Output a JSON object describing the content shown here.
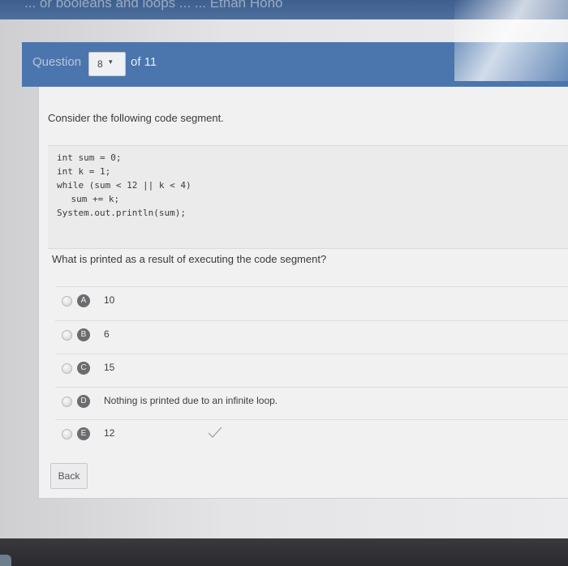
{
  "window": {
    "title": "... or booleans and loops ... ... Ethan Hono"
  },
  "header": {
    "question_label": "Question",
    "current_question": "8",
    "of_label": "of 11"
  },
  "question": {
    "prompt": "Consider the following code segment.",
    "code": [
      "int sum = 0;",
      "int k = 1;",
      "while (sum < 12 || k < 4)",
      "    sum += k;",
      "System.out.println(sum);"
    ],
    "text": "What is printed as a result of executing the code segment?",
    "options": [
      {
        "letter": "A",
        "text": "10"
      },
      {
        "letter": "B",
        "text": "6"
      },
      {
        "letter": "C",
        "text": "15"
      },
      {
        "letter": "D",
        "text": "Nothing is printed due to an infinite loop."
      },
      {
        "letter": "E",
        "text": "12"
      }
    ]
  },
  "footer": {
    "back_label": "Back"
  },
  "icons": {
    "dropdown": "chevron-down-icon",
    "checkmark": "checkmark-icon"
  },
  "colors": {
    "header_bar": "#4b76ad",
    "badge": "#6c6c70",
    "panel": "#f1f1f2"
  }
}
